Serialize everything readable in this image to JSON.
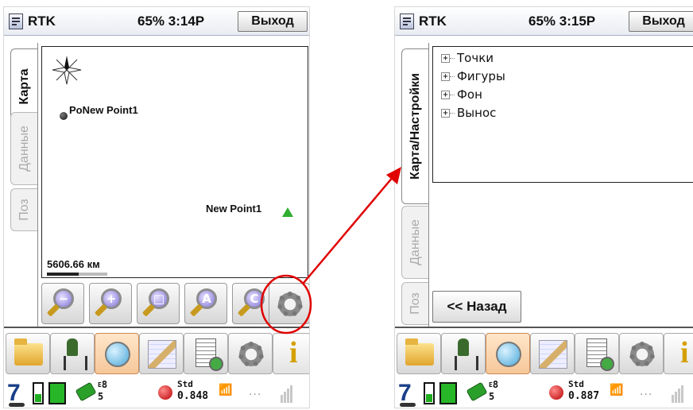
{
  "left_screen": {
    "title": "RTK",
    "status": "65% 3:14P",
    "exit_label": "Выход",
    "tabs": [
      "Карта",
      "Данные",
      "Поз"
    ],
    "map": {
      "points": [
        {
          "label": "PoNew Point1"
        },
        {
          "label": "New Point1"
        }
      ],
      "scale": "5606.66 км"
    },
    "zoom_buttons": [
      "zoom-out",
      "zoom-in",
      "zoom-extents",
      "zoom-all",
      "zoom-center",
      "map-settings"
    ],
    "zoom_glyphs": [
      "−",
      "+",
      "□",
      "A",
      "C"
    ]
  },
  "right_screen": {
    "title": "RTK",
    "status": "65% 3:15P",
    "exit_label": "Выход",
    "tabs": [
      "Карта/Настройки",
      "Данные",
      "Поз"
    ],
    "tree_items": [
      "Точки",
      "Фигуры",
      "Фон",
      "Вынос"
    ],
    "back_label": "<< Назад"
  },
  "toolbar": {
    "icons": [
      "folder-icon",
      "survey-icon",
      "map-icon",
      "cogo-icon",
      "data-icon",
      "settings-icon",
      "info-icon"
    ]
  },
  "statusbar_left": {
    "sats_top": "8",
    "sats_bottom": "5",
    "sats_super": "E",
    "std_label": "Std",
    "std_value": "0.848",
    "dots": "..."
  },
  "statusbar_right": {
    "sats_top": "8",
    "sats_bottom": "5",
    "sats_super": "E",
    "std_label": "Std",
    "std_value": "0.887",
    "dots": "..."
  },
  "annotation": {
    "arrow_color": "#e00000"
  }
}
